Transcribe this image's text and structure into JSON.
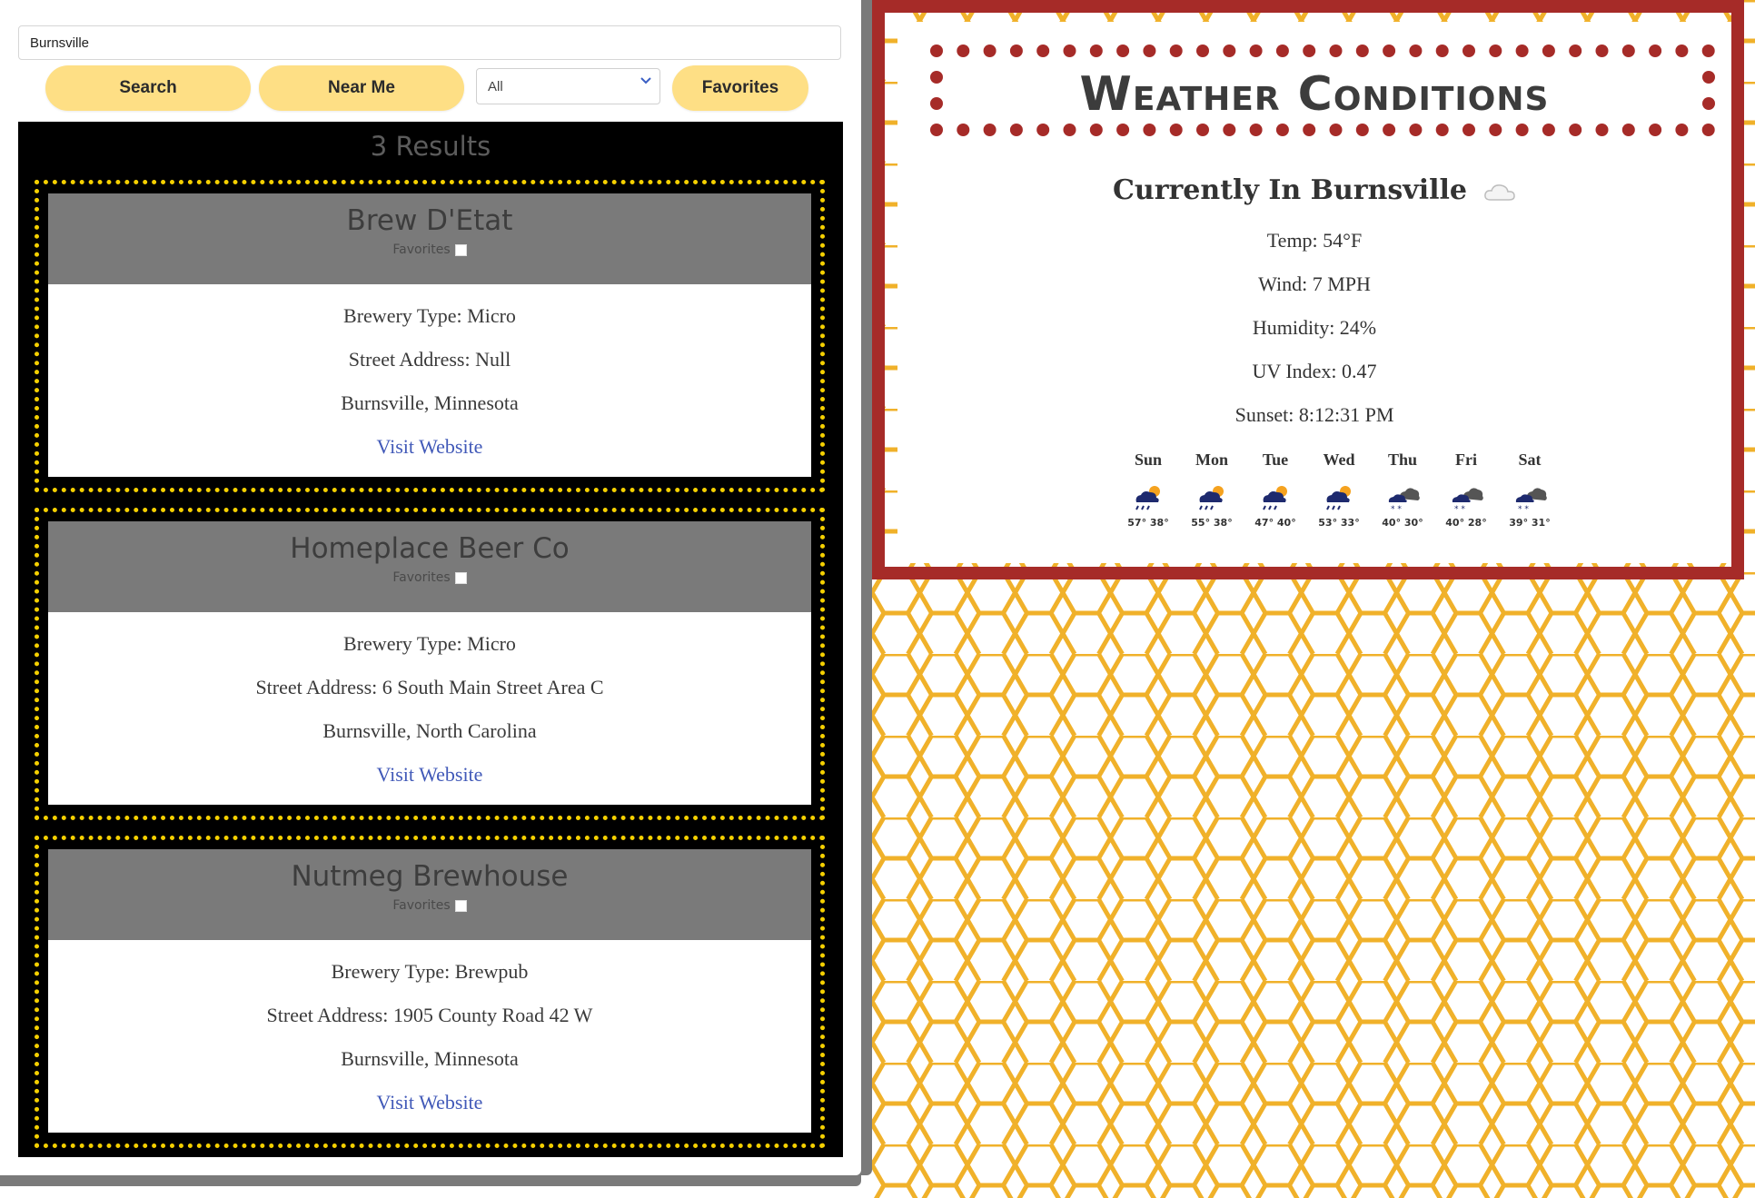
{
  "search": {
    "value": "Burnsville",
    "search_label": "Search",
    "near_me_label": "Near Me",
    "type_filter": "All",
    "favorites_label": "Favorites"
  },
  "results": {
    "count_text": "3 Results",
    "cards": [
      {
        "name": "Brew D'Etat",
        "favorites_label": "Favorites",
        "type": "Brewery Type: Micro",
        "address": "Street Address: Null",
        "location": "Burnsville, Minnesota",
        "link": "Visit Website"
      },
      {
        "name": "Homeplace Beer Co",
        "favorites_label": "Favorites",
        "type": "Brewery Type: Micro",
        "address": "Street Address: 6 South Main Street Area C",
        "location": "Burnsville, North Carolina",
        "link": "Visit Website"
      },
      {
        "name": "Nutmeg Brewhouse",
        "favorites_label": "Favorites",
        "type": "Brewery Type: Brewpub",
        "address": "Street Address: 1905 County Road 42 W",
        "location": "Burnsville, Minnesota",
        "link": "Visit Website"
      }
    ]
  },
  "weather": {
    "title": "Weather Conditions",
    "current_heading": "Currently In Burnsville",
    "current_icon": "cloud-icon",
    "temp": "Temp: 54°F",
    "wind": "Wind: 7 MPH",
    "humidity": "Humidity: 24%",
    "uv": "UV Index: 0.47",
    "sunset": "Sunset: 8:12:31 PM",
    "forecast": [
      {
        "day": "Sun",
        "temps": "57° 38°",
        "icon": "sun-rain-icon"
      },
      {
        "day": "Mon",
        "temps": "55° 38°",
        "icon": "sun-rain-icon"
      },
      {
        "day": "Tue",
        "temps": "47° 40°",
        "icon": "sun-rain-icon"
      },
      {
        "day": "Wed",
        "temps": "53° 33°",
        "icon": "sun-rain-icon"
      },
      {
        "day": "Thu",
        "temps": "40° 30°",
        "icon": "snow-cloud-icon"
      },
      {
        "day": "Fri",
        "temps": "40° 28°",
        "icon": "snow-cloud-icon"
      },
      {
        "day": "Sat",
        "temps": "39° 31°",
        "icon": "snow-cloud-icon"
      }
    ]
  },
  "colors": {
    "button": "#fedf85",
    "card_border": "#f5d000",
    "weather_border": "#a62b28",
    "hex_stroke": "#f0b12a",
    "link": "#4159b8"
  }
}
